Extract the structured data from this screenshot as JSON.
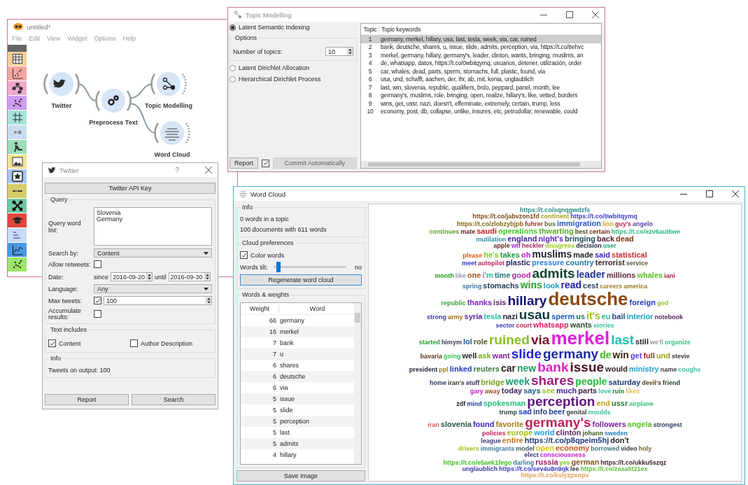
{
  "main_window": {
    "title": "untitled*",
    "menu": [
      "File",
      "Edit",
      "View",
      "Widget",
      "Options",
      "Help"
    ],
    "toolbox": [
      {
        "kind": "table",
        "color": "#f6cf95"
      },
      {
        "kind": "scatter",
        "color": "#f4a6a0"
      },
      {
        "kind": "tree",
        "color": "#f3a7cc"
      },
      {
        "kind": "dots",
        "color": "#cf9cf0"
      },
      {
        "kind": "grid",
        "color": "#a6e3dc"
      },
      {
        "kind": "blob",
        "color": "#c9dcf0"
      },
      {
        "kind": "figure",
        "color": "#9edcb6"
      },
      {
        "kind": "image",
        "color": "#f2e493"
      },
      {
        "kind": "star",
        "color": "#a9c6f2"
      },
      {
        "kind": "line",
        "color": "#d6cd6a"
      },
      {
        "kind": "network",
        "color": "#6fc6a4"
      },
      {
        "kind": "cap",
        "color": "#e0463e"
      },
      {
        "kind": "text",
        "color": "#c6dcf8"
      },
      {
        "kind": "chart",
        "color": "#4a98e4"
      },
      {
        "kind": "dots",
        "color": "#9ce46a"
      }
    ],
    "nodes": [
      {
        "label": "Twitter",
        "kind": "twitter"
      },
      {
        "label": "Preprocess Text",
        "kind": "preprocess"
      },
      {
        "label": "Topic Modelling",
        "kind": "topics"
      },
      {
        "label": "Word Cloud",
        "kind": "cloud"
      }
    ]
  },
  "topic_modelling": {
    "title": "Topic Modelling",
    "methods": [
      {
        "label": "Latent Semantic Indexing",
        "selected": true
      },
      {
        "label": "Latent Dirichlet Allocation",
        "selected": false
      },
      {
        "label": "Hierarchical Dirichlet Process",
        "selected": false
      }
    ],
    "options": {
      "title": "Options",
      "topics_label": "Number of topics:",
      "topics": "10"
    },
    "report_button": "Report",
    "auto_commit": true,
    "commit_button": "Commit Automatically",
    "commit_disabled": true,
    "table": {
      "columns": [
        "Topic",
        "Topic keywords"
      ],
      "rows": [
        {
          "topic": "1",
          "keywords": "germany, merkel, hillary, usa, last, tesla, week, via, car, ruined",
          "selected": true
        },
        {
          "topic": "2",
          "keywords": "bank, deutsche, shares, u, issue, slide, admits, perception, via, https://t.co/8ehvc",
          "selected": false
        },
        {
          "topic": "3",
          "keywords": "merkel, germany, hillary, germany's, leader, clinton, wants, bringing, muslims, an",
          "selected": false
        },
        {
          "topic": "4",
          "keywords": "de, whatsapp, datos, https://t.co/0wbitqymq, usuarios, detener, utilización, order",
          "selected": false
        },
        {
          "topic": "5",
          "keywords": "car, whales, dead, parts, sperm, stomachs, full, plastic, found, via",
          "selected": false
        },
        {
          "topic": "6",
          "keywords": "usa, und, schafft, aachen, der, ihr, ab, mit, kenia, unglaublich",
          "selected": false
        },
        {
          "topic": "7",
          "keywords": "last, win, slovenia, republic, qualifiers, brdo, peppard, panel, month, lee",
          "selected": false
        },
        {
          "topic": "8",
          "keywords": "germany's, muslims, role, bringing, open, realize, hillary's, like, vetted, borders",
          "selected": false
        },
        {
          "topic": "9",
          "keywords": "wins, get, ussr, nazi, doesn't, effeminate, extremely, certain, trump, less",
          "selected": false
        },
        {
          "topic": "10",
          "keywords": "economy, post, db, collapse, unlike, insures, etc, petrodollar, renewable, could",
          "selected": false
        }
      ]
    }
  },
  "twitter": {
    "title": "Twitter",
    "help": "?",
    "api_key_button": "Twitter API Key",
    "query": {
      "title": "Query",
      "word_list_label": "Query word list:",
      "word_list": [
        "Slovenia",
        "Germany"
      ],
      "search_by_label": "Search by:",
      "search_by": "Content",
      "allow_retweets_label": "Allow retweets:",
      "allow_retweets": false,
      "date_label": "Date:",
      "since_label": "since",
      "since": "2016-09-20",
      "until_label": "until",
      "until": "2016-09-30",
      "language_label": "Language:",
      "language": "Any",
      "max_tweets_label": "Max tweets:",
      "max_tweets_enabled": true,
      "max_tweets": "100",
      "accumulate_label": "Accumulate results:",
      "accumulate": false
    },
    "text_includes": {
      "title": "Text includes",
      "options": [
        {
          "label": "Content",
          "checked": true
        },
        {
          "label": "Author Description",
          "checked": false
        }
      ]
    },
    "info": {
      "title": "Info",
      "text": "Tweets on output: 100"
    },
    "buttons": [
      "Report",
      "Search"
    ]
  },
  "word_cloud": {
    "title": "Word Cloud",
    "info": {
      "title": "Info",
      "lines": [
        "0 words in a topic",
        "100 documents with 611 words"
      ]
    },
    "preferences": {
      "title": "Cloud preferences",
      "color_words_label": "Color words",
      "color_words": true,
      "tilt_label": "Words tilt:",
      "tilt": {
        "level": 0.04
      },
      "tilt_reading": "no",
      "regenerate_button": "Regenerate word cloud"
    },
    "weights": {
      "title": "Words & weights",
      "columns": [
        "Weight",
        "Word"
      ],
      "rows": [
        {
          "weight": "66",
          "word": "germany"
        },
        {
          "weight": "16",
          "word": "merkel"
        },
        {
          "weight": "7",
          "word": "bank"
        },
        {
          "weight": "7",
          "word": "u"
        },
        {
          "weight": "6",
          "word": "shares"
        },
        {
          "weight": "6",
          "word": "deutsche"
        },
        {
          "weight": "6",
          "word": "via"
        },
        {
          "weight": "5",
          "word": "issue"
        },
        {
          "weight": "5",
          "word": "slide"
        },
        {
          "weight": "5",
          "word": "perception"
        },
        {
          "weight": "5",
          "word": "last"
        },
        {
          "weight": "5",
          "word": "admits"
        },
        {
          "weight": "4",
          "word": "hillary"
        }
      ]
    },
    "save_button": "Save Image",
    "cloud": [
      {
        "words": [
          {
            "text": "https://t.co/sqnqgwdzfs",
            "kind": "xs",
            "color": "#2a8c8c"
          }
        ]
      },
      {
        "words": [
          {
            "text": "https://t.co/jabvzon1fd",
            "kind": "xs",
            "color": "#7a4a10"
          },
          {
            "text": "continent",
            "kind": "xs",
            "color": "#a8a020"
          },
          {
            "text": "https://t.co/0wbitqymq",
            "kind": "xs",
            "color": "#3a3ad0"
          }
        ]
      },
      {
        "words": [
          {
            "text": "https://t.co/zlobzybjpb",
            "kind": "xs",
            "color": "#806a10"
          },
          {
            "text": "fuhrer",
            "kind": "xs",
            "color": "#a03020"
          },
          {
            "text": "bus",
            "kind": "xs",
            "color": "#556b2f"
          },
          {
            "text": "immigration",
            "kind": "m",
            "color": "#2a55c8"
          },
          {
            "text": "lion",
            "kind": "xs",
            "color": "#c8a818"
          },
          {
            "text": "guy's",
            "kind": "xs",
            "color": "#b02848"
          },
          {
            "text": "angelo",
            "kind": "xs",
            "color": "#5a40a8"
          }
        ]
      },
      {
        "words": [
          {
            "text": "continues",
            "kind": "xs",
            "color": "#5aa02a"
          },
          {
            "text": "mate",
            "kind": "xs",
            "color": "#5a1e1e"
          },
          {
            "text": "saudi",
            "kind": "m",
            "color": "#c8202a"
          },
          {
            "text": "operations",
            "kind": "m",
            "color": "#3ccc20"
          },
          {
            "text": "thwarting",
            "kind": "m",
            "color": "#5aa828"
          },
          {
            "text": "best",
            "kind": "xs",
            "color": "#4a4a1a"
          },
          {
            "text": "certain",
            "kind": "xs",
            "color": "#6a2a10"
          },
          {
            "text": "https://t.co/ezv6aut6we",
            "kind": "xs",
            "color": "#2ab87a"
          }
        ]
      },
      {
        "words": [
          {
            "text": "mutilation",
            "kind": "xs",
            "color": "#2a88a8"
          },
          {
            "text": "england",
            "kind": "m",
            "color": "#40209a"
          },
          {
            "text": "night's",
            "kind": "m",
            "color": "#5a20c8"
          },
          {
            "text": "bringing",
            "kind": "m",
            "color": "#1e4a5a"
          },
          {
            "text": "back",
            "kind": "m",
            "color": "#4a1a3a"
          },
          {
            "text": "dead",
            "kind": "m",
            "color": "#7a3a10"
          }
        ]
      },
      {
        "words": [
          {
            "text": "apple",
            "kind": "xs",
            "color": "#5a2a1a"
          },
          {
            "text": "wtf",
            "kind": "xs",
            "color": "#a020c8"
          },
          {
            "text": "heckler",
            "kind": "xs",
            "color": "#a02a60"
          },
          {
            "text": "disagrees",
            "kind": "xs",
            "color": "#9ac820"
          },
          {
            "text": "decision",
            "kind": "xs",
            "color": "#1e1e3a"
          },
          {
            "text": "user",
            "kind": "xs",
            "color": "#1ea078"
          }
        ]
      },
      {
        "words": [
          {
            "text": "please",
            "kind": "xs",
            "color": "#e0601e"
          },
          {
            "text": "he's",
            "kind": "m",
            "color": "#7ac81e"
          },
          {
            "text": "takes",
            "kind": "m",
            "color": "#1e9a3a"
          },
          {
            "text": "oh",
            "kind": "m",
            "color": "#c01ee0"
          },
          {
            "text": "muslims",
            "kind": "l",
            "color": "#1e1e2a"
          },
          {
            "text": "made",
            "kind": "m",
            "color": "#1e1e1e"
          },
          {
            "text": "said",
            "kind": "m",
            "color": "#3a1ec8"
          },
          {
            "text": "statistical",
            "kind": "m",
            "color": "#c82a2a"
          }
        ]
      },
      {
        "words": [
          {
            "text": "meet",
            "kind": "xs",
            "color": "#2a3ac8"
          },
          {
            "text": "autopilot",
            "kind": "xs",
            "color": "#c01e5a"
          },
          {
            "text": "plastic",
            "kind": "m",
            "color": "#1e1e5a"
          },
          {
            "text": "pressure",
            "kind": "m",
            "color": "#1e80e0"
          },
          {
            "text": "country",
            "kind": "m",
            "color": "#1e7aa0"
          },
          {
            "text": "terrorist",
            "kind": "m",
            "color": "#3a1e1e"
          },
          {
            "text": "service",
            "kind": "xs",
            "color": "#5a5a3a"
          }
        ]
      },
      {
        "words": [
          {
            "text": "month",
            "kind": "xs",
            "color": "#1e9a1e"
          },
          {
            "text": "like",
            "kind": "xs",
            "color": "#9a9ac0"
          },
          {
            "text": "one",
            "kind": "m",
            "color": "#a0601e"
          },
          {
            "text": "i'm",
            "kind": "m",
            "color": "#1ec0a0"
          },
          {
            "text": "time",
            "kind": "m",
            "color": "#1e7a7a"
          },
          {
            "text": "good",
            "kind": "m",
            "color": "#c01ea0"
          },
          {
            "text": "admits",
            "kind": "xl",
            "color": "#0f4030"
          },
          {
            "text": "leader",
            "kind": "l",
            "color": "#1e2ea0"
          },
          {
            "text": "millions",
            "kind": "m",
            "color": "#5a1e3a"
          },
          {
            "text": "whales",
            "kind": "m",
            "color": "#5ac01e"
          },
          {
            "text": "iani",
            "kind": "xs",
            "color": "#a01e3a"
          }
        ]
      },
      {
        "words": [
          {
            "text": "spring",
            "kind": "xs",
            "color": "#3a7aa0"
          },
          {
            "text": "stomachs",
            "kind": "m",
            "color": "#1e3a5a"
          },
          {
            "text": "wins",
            "kind": "l",
            "color": "#2aa02a"
          },
          {
            "text": "look",
            "kind": "m",
            "color": "#1ea0c0"
          },
          {
            "text": "read",
            "kind": "l",
            "color": "#1e1ea0"
          },
          {
            "text": "cest",
            "kind": "m",
            "color": "#1e3a5a"
          },
          {
            "text": "careers",
            "kind": "xs",
            "color": "#a0802a"
          },
          {
            "text": "america",
            "kind": "xs",
            "color": "#a07a2a"
          }
        ]
      },
      {
        "words": [
          {
            "text": "republic",
            "kind": "xs",
            "color": "#3aa03a"
          },
          {
            "text": "thanks",
            "kind": "m",
            "color": "#7a1ec0"
          },
          {
            "text": "isis",
            "kind": "m",
            "color": "#5a1e5a"
          },
          {
            "text": "hillary",
            "kind": "xl",
            "color": "#10107a"
          },
          {
            "text": "deutsche",
            "kind": "xxl",
            "color": "#8a4a10"
          },
          {
            "text": "foreign",
            "kind": "m",
            "color": "#1e3ac0"
          },
          {
            "text": "god",
            "kind": "xs",
            "color": "#9ac03a"
          }
        ]
      },
      {
        "words": [
          {
            "text": "strong",
            "kind": "xs",
            "color": "#3a3aa0"
          },
          {
            "text": "army",
            "kind": "xs",
            "color": "#a0700f"
          },
          {
            "text": "syria",
            "kind": "m",
            "color": "#5a1ea0"
          },
          {
            "text": "tesla",
            "kind": "m",
            "color": "#1ec0a0"
          },
          {
            "text": "nazi",
            "kind": "m",
            "color": "#1e1e3a"
          },
          {
            "text": "usau",
            "kind": "xl",
            "color": "#0f3a3a"
          },
          {
            "text": "sperm",
            "kind": "m",
            "color": "#1e5ac0"
          },
          {
            "text": "us",
            "kind": "m",
            "color": "#1e7a5a"
          },
          {
            "text": "it's",
            "kind": "l",
            "color": "#a0c01e"
          },
          {
            "text": "eu",
            "kind": "m",
            "color": "#1ec0a0"
          },
          {
            "text": "bail",
            "kind": "m",
            "color": "#1e4a7a"
          },
          {
            "text": "interior",
            "kind": "m",
            "color": "#1ea0c0"
          },
          {
            "text": "notebook",
            "kind": "xs",
            "color": "#5a2a5a"
          }
        ]
      },
      {
        "words": [
          {
            "text": "sector",
            "kind": "xs",
            "color": "#3a3ac0"
          },
          {
            "text": "court",
            "kind": "xs",
            "color": "#c01e5a"
          },
          {
            "text": "whatsapp",
            "kind": "m",
            "color": "#e01e5a"
          },
          {
            "text": "wants",
            "kind": "m",
            "color": "#2a4a2a"
          },
          {
            "text": "stories",
            "kind": "xs",
            "color": "#3ac0a0"
          }
        ]
      },
      {
        "words": [
          {
            "text": "started",
            "kind": "xs",
            "color": "#1ea03a"
          },
          {
            "text": "himym",
            "kind": "xs",
            "color": "#3a3a5a"
          },
          {
            "text": "lol",
            "kind": "m",
            "color": "#1e5aa0"
          },
          {
            "text": "role",
            "kind": "m",
            "color": "#4a5a1e"
          },
          {
            "text": "ruined",
            "kind": "xl",
            "color": "#88c01e"
          },
          {
            "text": "via",
            "kind": "xl",
            "color": "#7a0f2a"
          },
          {
            "text": "merkel",
            "kind": "xxl",
            "color": "#e01ee0"
          },
          {
            "text": "last",
            "kind": "xl",
            "color": "#1ec0b0"
          },
          {
            "text": "still",
            "kind": "m",
            "color": "#1e1e1e"
          },
          {
            "text": "we'll",
            "kind": "xs",
            "color": "#9a9a9a"
          },
          {
            "text": "organize",
            "kind": "xs",
            "color": "#3ac07a"
          }
        ]
      },
      {
        "words": [
          {
            "text": "bavaria",
            "kind": "xs",
            "color": "#5a3a1e"
          },
          {
            "text": "going",
            "kind": "xs",
            "color": "#3ac05a"
          },
          {
            "text": "well",
            "kind": "m",
            "color": "#1e1e1e"
          },
          {
            "text": "ask",
            "kind": "m",
            "color": "#7ab01e"
          },
          {
            "text": "want",
            "kind": "m",
            "color": "#7a1e9a"
          },
          {
            "text": "slide",
            "kind": "xl",
            "color": "#1e1ed0"
          },
          {
            "text": "germany",
            "kind": "xl",
            "color": "#1e2aa0"
          },
          {
            "text": "de",
            "kind": "l",
            "color": "#3ac01e"
          },
          {
            "text": "win",
            "kind": "l",
            "color": "#3a1e0f"
          },
          {
            "text": "get",
            "kind": "m",
            "color": "#5a3ae0"
          },
          {
            "text": "full",
            "kind": "m",
            "color": "#c01e1e"
          },
          {
            "text": "und",
            "kind": "m",
            "color": "#a0a01e"
          },
          {
            "text": "stevie",
            "kind": "xs",
            "color": "#3a3a3a"
          }
        ]
      },
      {
        "words": [
          {
            "text": "president",
            "kind": "xs",
            "color": "#1e1e3a"
          },
          {
            "text": "ppl",
            "kind": "xs",
            "color": "#a07a1e"
          },
          {
            "text": "linked",
            "kind": "m",
            "color": "#1e3ac0"
          },
          {
            "text": "reuters",
            "kind": "m",
            "color": "#3a7a3a"
          },
          {
            "text": "car",
            "kind": "l",
            "color": "#2a1e1e"
          },
          {
            "text": "new",
            "kind": "l",
            "color": "#1ea05a"
          },
          {
            "text": "bank",
            "kind": "xl",
            "color": "#e01ed0"
          },
          {
            "text": "issue",
            "kind": "xl",
            "color": "#4a0f1e"
          },
          {
            "text": "would",
            "kind": "m",
            "color": "#2a1e1e"
          },
          {
            "text": "ministry",
            "kind": "m",
            "color": "#1ea0d0"
          },
          {
            "text": "name",
            "kind": "xs",
            "color": "#3a3a3a"
          },
          {
            "text": "coughs",
            "kind": "xs",
            "color": "#3ac0a0"
          }
        ]
      },
      {
        "words": [
          {
            "text": "home",
            "kind": "xs",
            "color": "#1e3a5a"
          },
          {
            "text": "iran's",
            "kind": "xs",
            "color": "#3a3a1e"
          },
          {
            "text": "stuff",
            "kind": "xs",
            "color": "#1e1e5a"
          },
          {
            "text": "bridge",
            "kind": "m",
            "color": "#7aa01e"
          },
          {
            "text": "week",
            "kind": "l",
            "color": "#1e9a7a"
          },
          {
            "text": "shares",
            "kind": "xl",
            "color": "#9a1e7a"
          },
          {
            "text": "people",
            "kind": "l",
            "color": "#1ec03a"
          },
          {
            "text": "saturday",
            "kind": "m",
            "color": "#1e3a7a"
          },
          {
            "text": "devil's",
            "kind": "xs",
            "color": "#5a3a1e"
          },
          {
            "text": "friend",
            "kind": "xs",
            "color": "#1e3a3a"
          }
        ]
      },
      {
        "words": [
          {
            "text": "gary",
            "kind": "xs",
            "color": "#c01ec0"
          },
          {
            "text": "away",
            "kind": "xs",
            "color": "#a04a1e"
          },
          {
            "text": "today",
            "kind": "m",
            "color": "#3a1e5a"
          },
          {
            "text": "says",
            "kind": "m",
            "color": "#1e5a7a"
          },
          {
            "text": "see",
            "kind": "m",
            "color": "#9ac01e"
          },
          {
            "text": "much",
            "kind": "m",
            "color": "#3a1ea0"
          },
          {
            "text": "parts",
            "kind": "m",
            "color": "#3a1e3a"
          },
          {
            "text": "love",
            "kind": "xs",
            "color": "#3ac0a0"
          },
          {
            "text": "ruin",
            "kind": "xs",
            "color": "#1e7a3a"
          },
          {
            "text": "likes",
            "kind": "xs",
            "color": "#e0c05a"
          }
        ]
      },
      {
        "words": [
          {
            "text": "zdf",
            "kind": "xs",
            "color": "#1e1e1e"
          },
          {
            "text": "mind",
            "kind": "xs",
            "color": "#1e3aa0"
          },
          {
            "text": "spokesman",
            "kind": "m",
            "color": "#1ec07a"
          },
          {
            "text": "perception",
            "kind": "xl",
            "color": "#5a0f7a"
          },
          {
            "text": "end",
            "kind": "m",
            "color": "#c0a01e"
          },
          {
            "text": "ussr",
            "kind": "m",
            "color": "#1e7a3a"
          },
          {
            "text": "airplane",
            "kind": "xs",
            "color": "#3ac07a"
          }
        ]
      },
      {
        "words": [
          {
            "text": "trump",
            "kind": "xs",
            "color": "#1e3a3a"
          },
          {
            "text": "sad",
            "kind": "m",
            "color": "#1e3ac0"
          },
          {
            "text": "info",
            "kind": "m",
            "color": "#1e3a7a"
          },
          {
            "text": "beer",
            "kind": "m",
            "color": "#1e3a9a"
          },
          {
            "text": "genital",
            "kind": "xs",
            "color": "#3a3a3a"
          },
          {
            "text": "moulds",
            "kind": "xs",
            "color": "#3ac0a0"
          }
        ]
      },
      {
        "words": [
          {
            "text": "iran",
            "kind": "xs",
            "color": "#e05a5a"
          },
          {
            "text": "slovenia",
            "kind": "m",
            "color": "#1e5a3a"
          },
          {
            "text": "found",
            "kind": "m",
            "color": "#3a1ec0"
          },
          {
            "text": "favorite",
            "kind": "m",
            "color": "#a07a1e"
          },
          {
            "text": "germany's",
            "kind": "xl",
            "color": "#c01e5a"
          },
          {
            "text": "followers",
            "kind": "m",
            "color": "#7a1ea0"
          },
          {
            "text": "angela",
            "kind": "m",
            "color": "#5ac01e"
          },
          {
            "text": "strongest",
            "kind": "xs",
            "color": "#1e3a5a"
          }
        ]
      },
      {
        "words": [
          {
            "text": "policies",
            "kind": "xs",
            "color": "#c01e5a"
          },
          {
            "text": "europe",
            "kind": "m",
            "color": "#a0c01e"
          },
          {
            "text": "world",
            "kind": "m",
            "color": "#1ea0e0"
          },
          {
            "text": "clinton",
            "kind": "m",
            "color": "#5a1e5a"
          },
          {
            "text": "johann",
            "kind": "xs",
            "color": "#3a5a1e"
          },
          {
            "text": "sweden",
            "kind": "xs",
            "color": "#1e7ac0"
          }
        ]
      },
      {
        "words": [
          {
            "text": "league",
            "kind": "xs",
            "color": "#3a3a7a"
          },
          {
            "text": "entire",
            "kind": "m",
            "color": "#c07a1e"
          },
          {
            "text": "https://t.co/p8qpeim5hj",
            "kind": "m",
            "color": "#1e3a7a"
          },
          {
            "text": "don't",
            "kind": "m",
            "color": "#1e1e1e"
          }
        ]
      },
      {
        "words": [
          {
            "text": "drivers",
            "kind": "xs",
            "color": "#9ac01e"
          },
          {
            "text": "immigrants",
            "kind": "xs",
            "color": "#3a7aa0"
          },
          {
            "text": "model",
            "kind": "xs",
            "color": "#3a5a5a"
          },
          {
            "text": "open",
            "kind": "m",
            "color": "#e0c01e"
          },
          {
            "text": "economy",
            "kind": "m",
            "color": "#c05a1e"
          },
          {
            "text": "borrowed",
            "kind": "xs",
            "color": "#3a7a7a"
          },
          {
            "text": "video",
            "kind": "xs",
            "color": "#3a3a3a"
          },
          {
            "text": "holy",
            "kind": "xs",
            "color": "#7a5a3a"
          }
        ]
      },
      {
        "words": [
          {
            "text": "elect",
            "kind": "xs",
            "color": "#3a3a7a"
          },
          {
            "text": "consciousness",
            "kind": "xs",
            "color": "#c01ec0"
          }
        ]
      },
      {
        "words": [
          {
            "text": "https://t.co/e5aek1fego",
            "kind": "xs",
            "color": "#3ac01e"
          },
          {
            "text": "darling",
            "kind": "xs",
            "color": "#3a7aa0"
          },
          {
            "text": "russia",
            "kind": "m",
            "color": "#9a1e5a"
          },
          {
            "text": "yes",
            "kind": "xs",
            "color": "#7ac01e"
          },
          {
            "text": "german",
            "kind": "m",
            "color": "#7a5a1e"
          },
          {
            "text": "https://t.co/ukku5szqz",
            "kind": "xs",
            "color": "#3a1e1e"
          }
        ]
      },
      {
        "words": [
          {
            "text": "unglaublich",
            "kind": "xs",
            "color": "#3a3aa0"
          },
          {
            "text": "https://t.co/sev4u8n9qk",
            "kind": "xs",
            "color": "#3a3ac0"
          },
          {
            "text": "lee",
            "kind": "xs",
            "color": "#3a3a3a"
          },
          {
            "text": "https://t.co/zasa5t21ex",
            "kind": "xs",
            "color": "#5ac03a"
          }
        ]
      },
      {
        "words": [
          {
            "text": "https://t.co/kslyzpxopv",
            "kind": "xs",
            "color": "#e0a05a"
          }
        ]
      }
    ]
  }
}
